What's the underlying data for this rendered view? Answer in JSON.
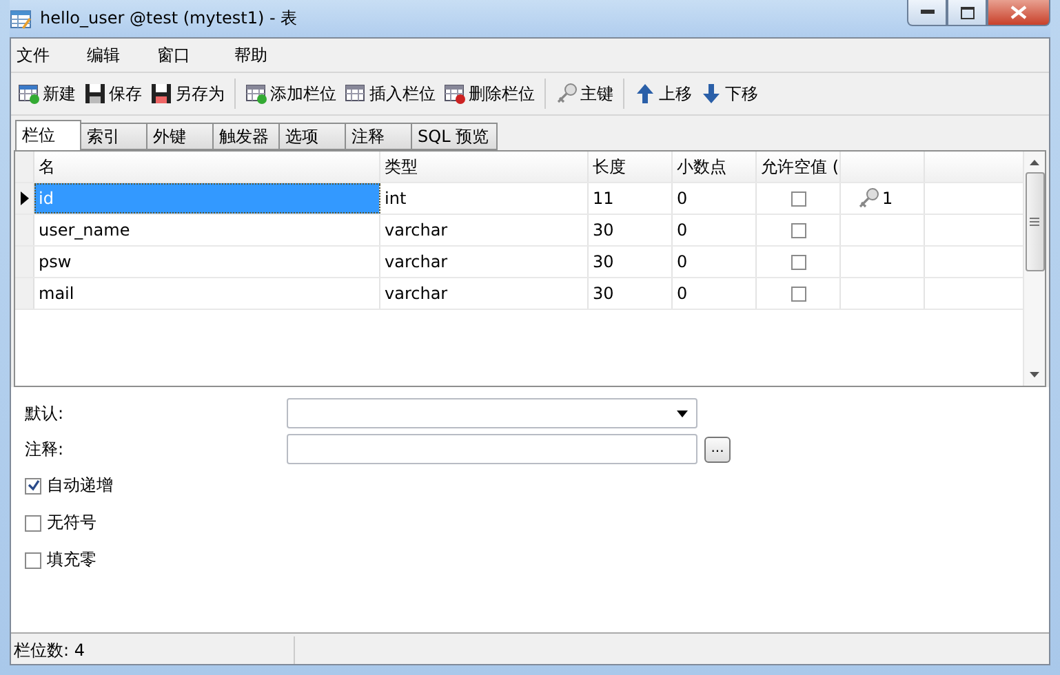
{
  "window": {
    "title": "hello_user @test (mytest1) - 表"
  },
  "menu": [
    "文件",
    "编辑",
    "窗口",
    "帮助"
  ],
  "toolbar": [
    {
      "kind": "new",
      "label": "新建"
    },
    {
      "kind": "save",
      "label": "保存"
    },
    {
      "kind": "saveas",
      "label": "另存为"
    },
    {
      "kind": "sep"
    },
    {
      "kind": "addcol",
      "label": "添加栏位"
    },
    {
      "kind": "inscol",
      "label": "插入栏位"
    },
    {
      "kind": "delcol",
      "label": "删除栏位"
    },
    {
      "kind": "sep"
    },
    {
      "kind": "key",
      "label": "主键"
    },
    {
      "kind": "sep"
    },
    {
      "kind": "up",
      "label": "上移"
    },
    {
      "kind": "down",
      "label": "下移"
    }
  ],
  "tabs": [
    {
      "label": "栏位",
      "selected": true
    },
    {
      "label": "索引",
      "selected": false
    },
    {
      "label": "外键",
      "selected": false
    },
    {
      "label": "触发器",
      "selected": false
    },
    {
      "label": "选项",
      "selected": false
    },
    {
      "label": "注释",
      "selected": false
    },
    {
      "label": "SQL 预览",
      "selected": false
    }
  ],
  "table": {
    "columns": [
      "名",
      "类型",
      "长度",
      "小数点",
      "允许空值 ("
    ],
    "rows": [
      {
        "name": "id",
        "type": "int",
        "length": "11",
        "decimals": "0",
        "nullable": false,
        "key": "1",
        "selected": true
      },
      {
        "name": "user_name",
        "type": "varchar",
        "length": "30",
        "decimals": "0",
        "nullable": false,
        "selected": false
      },
      {
        "name": "psw",
        "type": "varchar",
        "length": "30",
        "decimals": "0",
        "nullable": false,
        "selected": false
      },
      {
        "name": "mail",
        "type": "varchar",
        "length": "30",
        "decimals": "0",
        "nullable": false,
        "selected": false
      }
    ]
  },
  "form": {
    "default_label": "默认:",
    "comment_label": "注释:",
    "more_button": "...",
    "options": [
      {
        "label": "自动递增",
        "checked": true
      },
      {
        "label": "无符号",
        "checked": false
      },
      {
        "label": "填充零",
        "checked": false
      }
    ]
  },
  "status_bar": "栏位数: 4"
}
